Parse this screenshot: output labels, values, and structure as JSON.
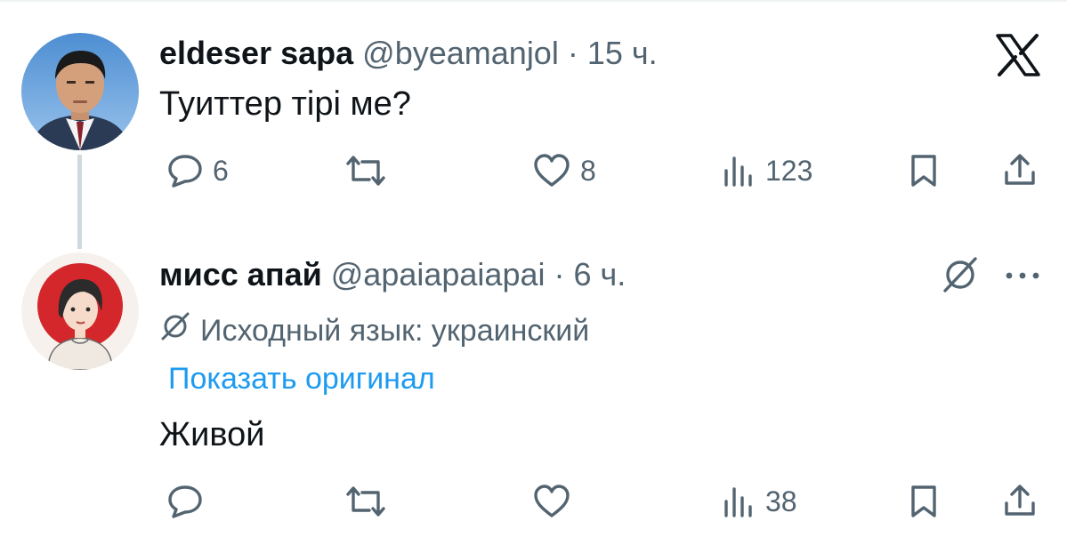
{
  "tweet": {
    "author_name": "eldeser sapa",
    "author_handle": "@byeamanjol",
    "separator": "·",
    "time": "15 ч.",
    "text": "Туиттер тірі ме?",
    "actions": {
      "replies": "6",
      "retweets": "",
      "likes": "8",
      "views": "123"
    }
  },
  "reply": {
    "author_name": "мисс апай",
    "author_handle": "@apaiapaiapai",
    "separator": "·",
    "time": "6 ч.",
    "translation_note": "Исходный язык: украинский",
    "show_original": "Показать оригинал",
    "text": "Живой",
    "actions": {
      "replies": "",
      "retweets": "",
      "likes": "",
      "views": "38"
    }
  },
  "icons": {
    "logo": "x-logo-icon",
    "reply": "speech-bubble-icon",
    "retweet": "retweet-arrows-icon",
    "like": "heart-icon",
    "views": "bar-chart-icon",
    "bookmark": "bookmark-icon",
    "share": "share-upload-icon",
    "translate": "translate-icon",
    "more": "more-dots-icon"
  },
  "colors": {
    "text_primary": "#0f1419",
    "text_secondary": "#536471",
    "link": "#1d9bf0",
    "thread_line": "#cfd9de",
    "reply_avatar_bg": "#d3272c"
  }
}
